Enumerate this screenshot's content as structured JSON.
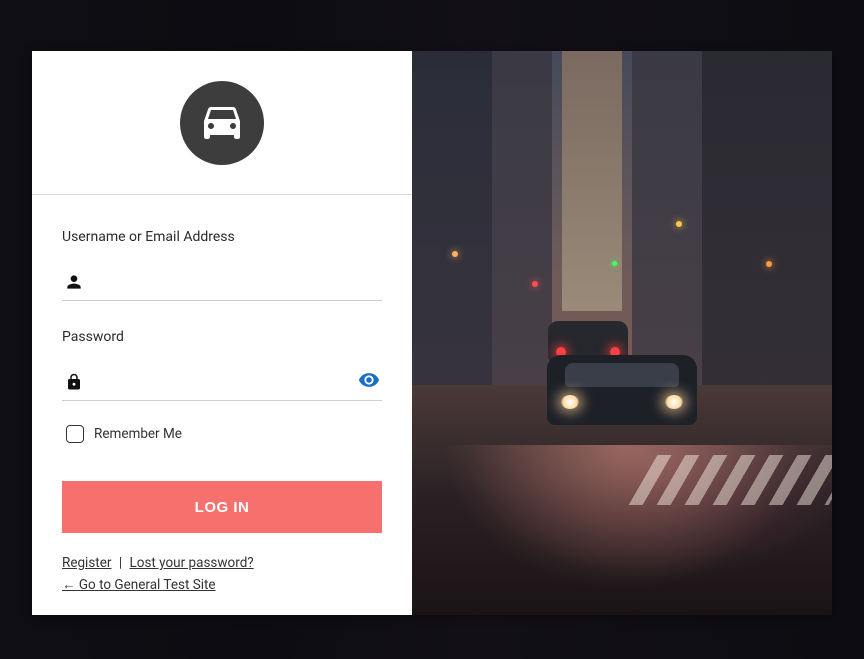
{
  "form": {
    "username_label": "Username or Email Address",
    "username_value": "",
    "password_label": "Password",
    "password_value": "",
    "remember_label": "Remember Me",
    "submit_label": "LOG IN"
  },
  "links": {
    "register": "Register",
    "separator": "|",
    "lost_password": "Lost your password?",
    "back_link": "← Go to General Test Site"
  },
  "icons": {
    "logo": "car-icon",
    "user": "person-icon",
    "lock": "lock-icon",
    "eye": "eye-icon"
  },
  "colors": {
    "accent": "#f6706d",
    "eye": "#1a6fc4"
  }
}
